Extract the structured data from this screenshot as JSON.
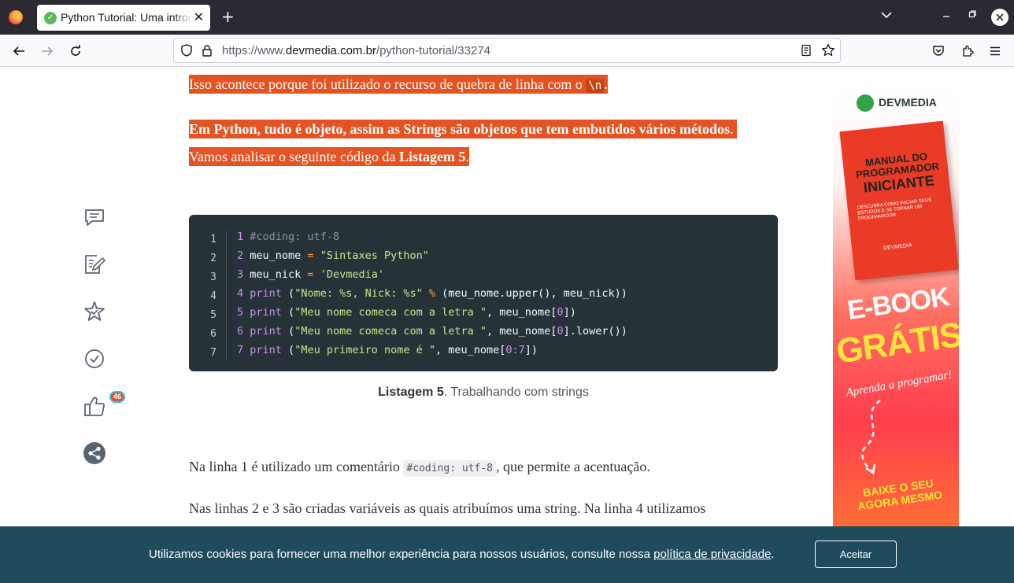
{
  "browser": {
    "tab_title": "Python Tutorial: Uma introdução",
    "tab_close": "✕",
    "new_tab": "+",
    "url_prefix": "https://www.",
    "url_host": "devmedia.com.br",
    "url_path": "/python-tutorial/33274"
  },
  "article": {
    "p1_text": "Isso acontece porque foi utilizado o recurso de quebra de linha com o ",
    "p1_code": "\\n",
    "p1_end": ".",
    "p2_bold": "Em Python, tudo é objeto, assim as Strings são objetos que tem embutidos vários métodos",
    "p2_dot": ".",
    "p3_text": "Vamos analisar o seguinte código da ",
    "p3_bold": "Listagem 5",
    "p3_end": ".",
    "code_lines": [
      {
        "n": "1",
        "parts": [
          {
            "t": "#coding: utf-8",
            "c": "cm"
          }
        ]
      },
      {
        "n": "2",
        "parts": [
          {
            "t": "meu_nome ",
            "c": ""
          },
          {
            "t": "=",
            "c": "op"
          },
          {
            "t": " \"Sintaxes Python\"",
            "c": "st"
          }
        ]
      },
      {
        "n": "3",
        "parts": [
          {
            "t": "meu_nick ",
            "c": ""
          },
          {
            "t": "=",
            "c": "op"
          },
          {
            "t": " 'Devmedia'",
            "c": "st"
          }
        ]
      },
      {
        "n": "4",
        "parts": [
          {
            "t": "print ",
            "c": "nm"
          },
          {
            "t": "(",
            "c": ""
          },
          {
            "t": "\"Nome: %s, Nick: %s\"",
            "c": "st"
          },
          {
            "t": " ",
            "c": ""
          },
          {
            "t": "%",
            "c": "op"
          },
          {
            "t": " (meu_nome.upper(), meu_nick))",
            "c": ""
          }
        ]
      },
      {
        "n": "5",
        "parts": [
          {
            "t": "print ",
            "c": "nm"
          },
          {
            "t": "(",
            "c": ""
          },
          {
            "t": "\"Meu nome comeca com a letra \"",
            "c": "st"
          },
          {
            "t": ", meu_nome[",
            "c": ""
          },
          {
            "t": "0",
            "c": "nm"
          },
          {
            "t": "])",
            "c": ""
          }
        ]
      },
      {
        "n": "6",
        "parts": [
          {
            "t": "print ",
            "c": "nm"
          },
          {
            "t": "(",
            "c": ""
          },
          {
            "t": "\"Meu nome comeca com a letra \"",
            "c": "st"
          },
          {
            "t": ", meu_nome[",
            "c": ""
          },
          {
            "t": "0",
            "c": "nm"
          },
          {
            "t": "].lower())",
            "c": ""
          }
        ]
      },
      {
        "n": "7",
        "parts": [
          {
            "t": "print ",
            "c": "nm"
          },
          {
            "t": "(",
            "c": ""
          },
          {
            "t": "\"Meu primeiro nome é \"",
            "c": "st"
          },
          {
            "t": ", meu_nome[",
            "c": ""
          },
          {
            "t": "0:7",
            "c": "nm"
          },
          {
            "t": "])",
            "c": ""
          }
        ]
      }
    ],
    "caption_bold": "Listagem 5",
    "caption_rest": ". Trabalhando com strings",
    "p4_text": "Na linha 1 é utilizado um comentário ",
    "p4_code": "#coding: utf-8",
    "p4_end": ", que permite a acentuação.",
    "p5_text": "Nas linhas 2 e 3 são criadas variáveis as quais atribuímos uma string. Na linha 4 utilizamos"
  },
  "sidebar": {
    "like_count": "46"
  },
  "ad": {
    "logo": "DEVMEDIA",
    "book_title_1": "MANUAL DO",
    "book_title_2": "PROGRAMADOR",
    "book_title_3": "INICIANTE",
    "book_sub": "DESCUBRA COMO INICIAR SEUS ESTUDOS E SE TORNAR UM PROGRAMADOR",
    "book_brand": "DEVMEDIA",
    "ebook": "E-BOOK",
    "gratis": "GRÁTIS",
    "aprenda": "Aprenda a programar!",
    "baixe": "BAIXE O SEU AGORA MESMO"
  },
  "cookie": {
    "text": "Utilizamos cookies para fornecer uma melhor experiência para nossos usuários, consulte nossa ",
    "link": "política de privacidade",
    "end": ".",
    "button": "Aceitar"
  }
}
